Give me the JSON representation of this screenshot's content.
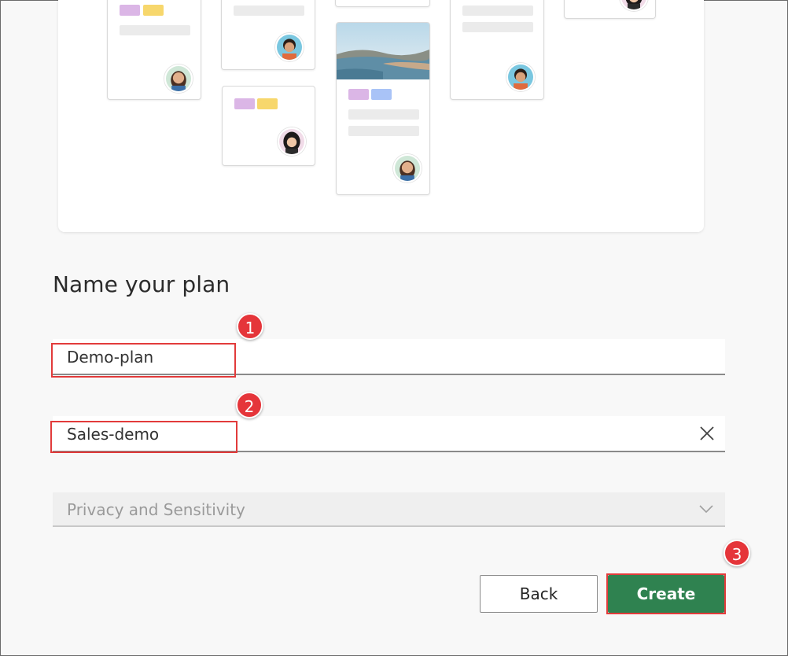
{
  "form": {
    "title": "Name your plan",
    "plan_name_value": "Demo-plan",
    "group_value": "Sales-demo",
    "privacy_placeholder": "Privacy and Sensitivity"
  },
  "buttons": {
    "back_label": "Back",
    "create_label": "Create"
  },
  "annotations": {
    "step1": "1",
    "step2": "2",
    "step3": "3"
  },
  "colors": {
    "accent": "#2f8250",
    "annotation": "#e23b3b"
  },
  "icons": {
    "clear": "close-icon",
    "dropdown": "chevron-down-icon"
  }
}
